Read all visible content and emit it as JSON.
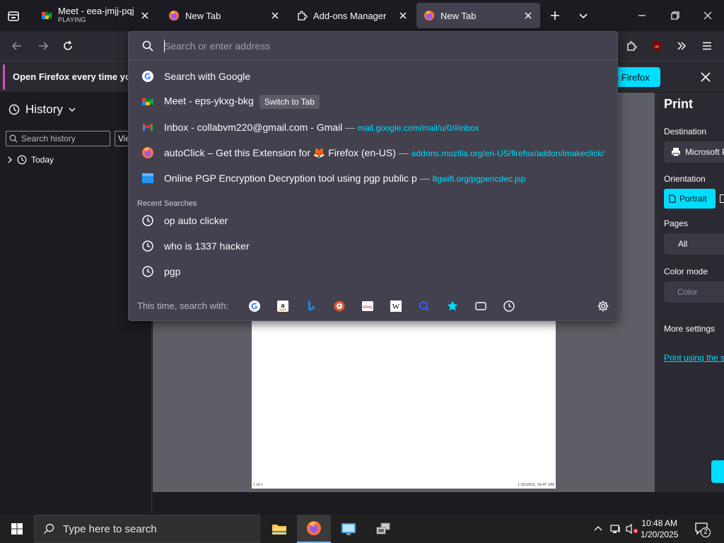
{
  "tabs": [
    {
      "title": "Meet - eea-jmjj-pqj",
      "subtitle": "PLAYING",
      "icon": "google-meet-icon"
    },
    {
      "title": "New Tab",
      "icon": "firefox-icon"
    },
    {
      "title": "Add-ons Manager",
      "icon": "puzzle-icon"
    },
    {
      "title": "New Tab",
      "icon": "firefox-icon",
      "active": true
    }
  ],
  "notification": {
    "message": "Open Firefox every time you",
    "button": "n Firefox"
  },
  "urlbar": {
    "placeholder": "Search or enter address",
    "results": [
      {
        "title": "Search with Google",
        "icon": "google-icon"
      },
      {
        "title": "Meet - eps-ykxg-bkg",
        "action": "Switch to Tab",
        "icon": "google-meet-icon"
      },
      {
        "title": "Inbox - collabvm220@gmail.com - Gmail",
        "sep": "—",
        "url": "mail.google.com/mail/u/0/#inbox",
        "icon": "gmail-icon"
      },
      {
        "title": "autoClick – Get this Extension for 🦊 Firefox (en-US)",
        "sep": "—",
        "url": "addons.mozilla.org/en-US/firefox/addon/imakeclick/",
        "icon": "firefox-icon"
      },
      {
        "title": "Online PGP Encryption Decryption tool using pgp public p",
        "sep": "—",
        "url": "8gwifi.org/pgpencdec.jsp",
        "icon": "site-icon"
      }
    ],
    "recent_header": "Recent Searches",
    "recent": [
      "op auto clicker",
      "who is 1337 hacker",
      "pgp"
    ],
    "oneoff_label": "This time, search with:",
    "engines": [
      "google-icon",
      "amazon-icon",
      "bing-icon",
      "duckduckgo-icon",
      "ebay-icon",
      "wikipedia-icon",
      "search-icon",
      "bookmarks-icon",
      "tabs-icon",
      "history-icon"
    ]
  },
  "sidebar": {
    "title": "History",
    "search_placeholder": "Search history",
    "view_label": "View",
    "today": "Today"
  },
  "print": {
    "title": "Print",
    "destination_label": "Destination",
    "destination_value": "Microsoft P",
    "orientation_label": "Orientation",
    "portrait": "Portrait",
    "pages_label": "Pages",
    "pages_value": "All",
    "color_label": "Color mode",
    "color_value": "Color",
    "more_settings": "More settings",
    "print_system": "Print using the s"
  },
  "preview": {
    "footer_left": "1 of 1",
    "footer_right": "1/20/2025, 10:47 AM"
  },
  "taskbar": {
    "search_placeholder": "Type here to search",
    "time": "10:48 AM",
    "date": "1/20/2025",
    "notifications": "2"
  },
  "colors": {
    "accent": "#00ddff",
    "panel": "#42414d",
    "chrome": "#2b2a33",
    "bg": "#1c1b22"
  }
}
